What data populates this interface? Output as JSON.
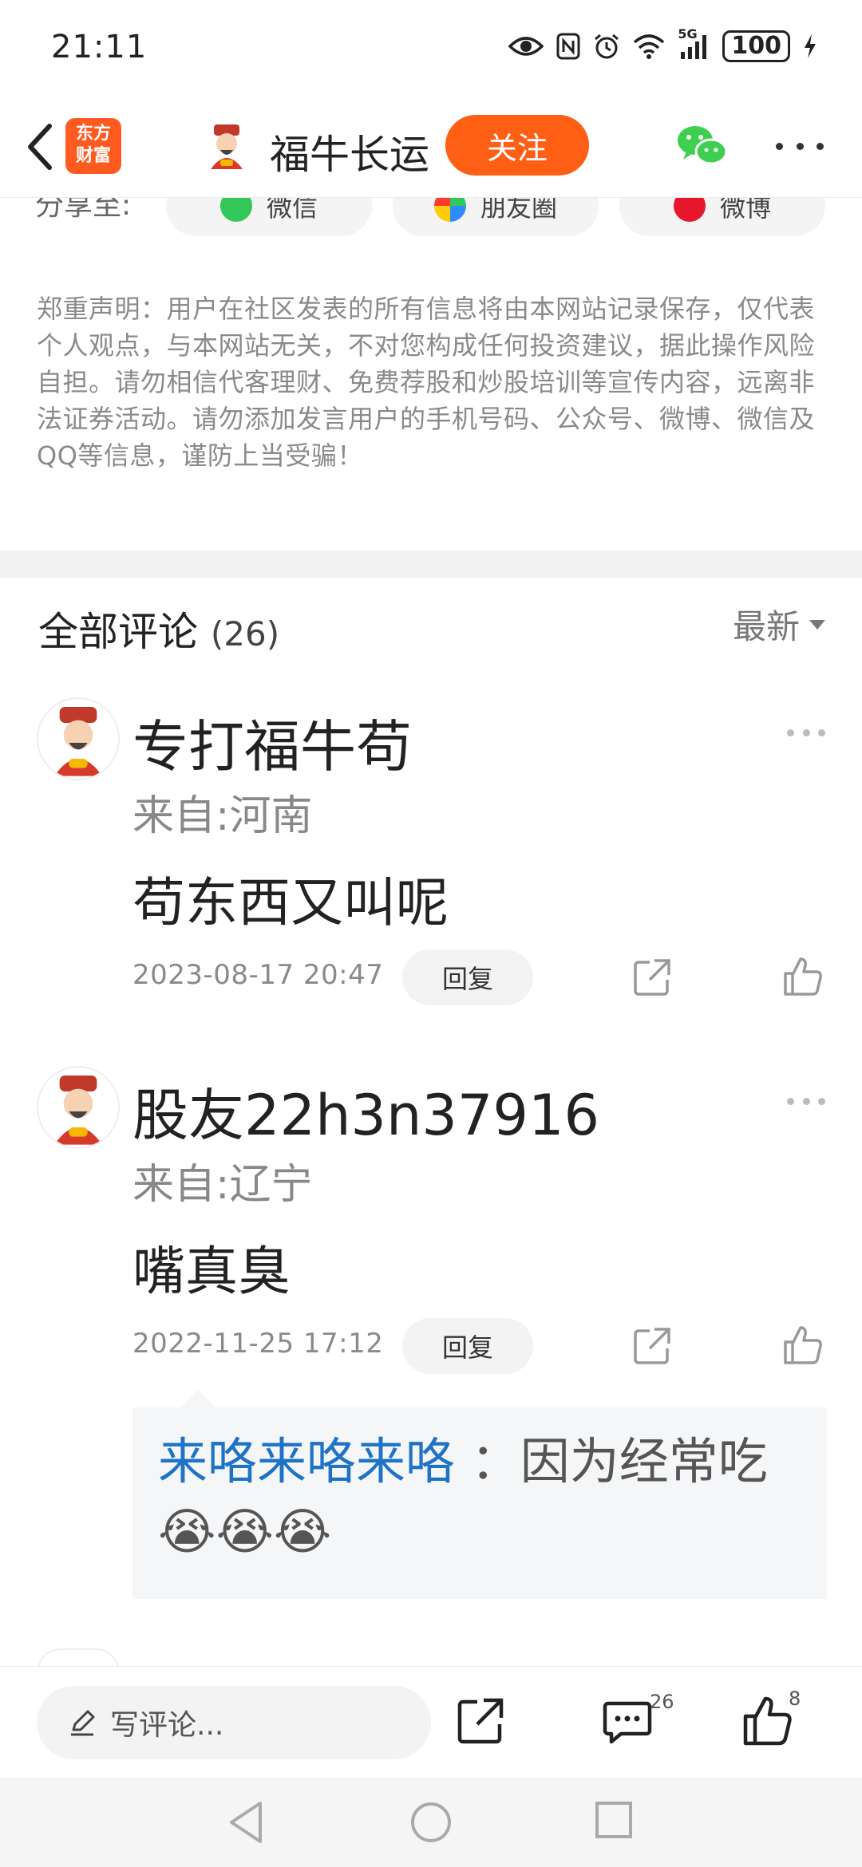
{
  "status_bar": {
    "time": "21:11",
    "battery": "100",
    "network": "5G",
    "icons": [
      "eye-icon",
      "nfc-icon",
      "alarm-icon",
      "wifi-icon",
      "signal-icon",
      "battery-icon",
      "charging-icon"
    ]
  },
  "nav": {
    "logo_text": "东方财富",
    "title": "福牛长运",
    "follow_label": "关注",
    "icons": [
      "back-icon",
      "wechat-icon",
      "more-icon"
    ]
  },
  "share": {
    "label": "分享至:",
    "buttons": [
      "微信",
      "朋友圈",
      "微博"
    ]
  },
  "disclaimer": "郑重声明：用户在社区发表的所有信息将由本网站记录保存，仅代表个人观点，与本网站无关，不对您构成任何投资建议，据此操作风险自担。请勿相信代客理财、免费荐股和炒股培训等宣传内容，远离非法证券活动。请勿添加发言用户的手机号码、公众号、微博、微信及QQ等信息，谨防上当受骗！",
  "comments_section": {
    "title": "全部评论",
    "count": "(26)",
    "sort_label": "最新"
  },
  "comments": [
    {
      "user": "专打福牛苟",
      "location": "来自:河南",
      "text": "苟东西又叫呢",
      "time": "2023-08-17 20:47",
      "reply_label": "回复"
    },
    {
      "user": "股友22h3n37916",
      "location": "来自:辽宁",
      "text": "嘴真臭",
      "time": "2022-11-25 17:12",
      "reply_label": "回复",
      "sub_reply": {
        "name": "来咯来咯来咯",
        "text": "：因为经常吃",
        "emoji": "😭😭😭"
      }
    }
  ],
  "bottom_bar": {
    "write_placeholder": "写评论...",
    "comment_count": "26",
    "like_count": "8"
  },
  "colors": {
    "accent": "#ff5e15",
    "link": "#1e73c6",
    "muted": "#8a8a8a"
  }
}
